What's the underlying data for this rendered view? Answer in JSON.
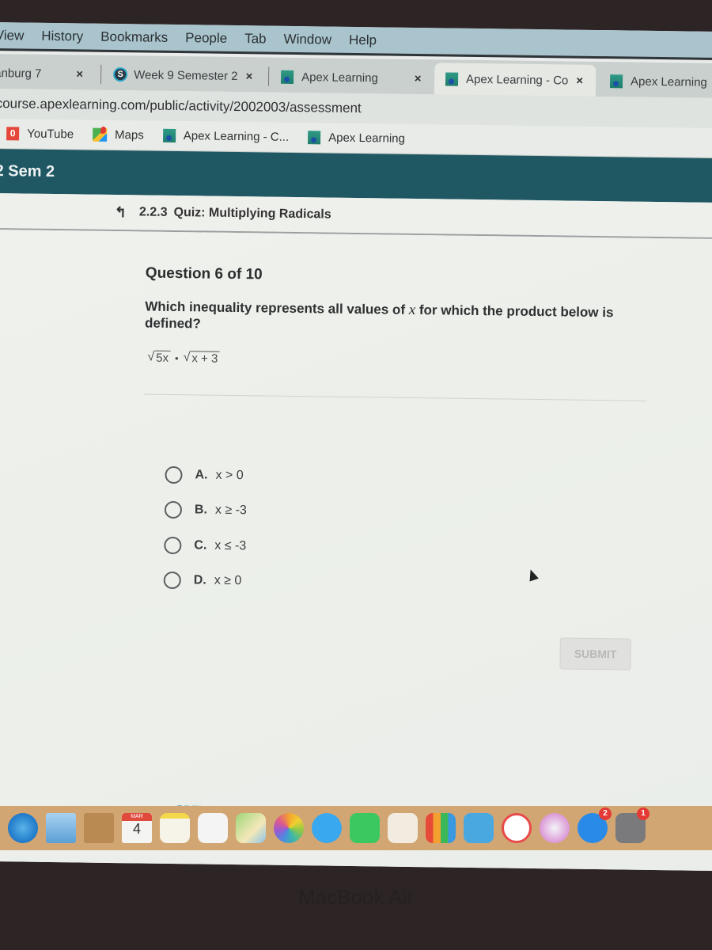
{
  "menubar": {
    "items": [
      "View",
      "History",
      "Bookmarks",
      "People",
      "Tab",
      "Window",
      "Help"
    ]
  },
  "tabs": [
    {
      "label": "anburg 7",
      "icon": "tab-favicon",
      "active": false
    },
    {
      "label": "Week 9 Semester 2",
      "icon": "schoology-icon",
      "active": false
    },
    {
      "label": "Apex Learning",
      "icon": "apex-icon",
      "active": false
    },
    {
      "label": "Apex Learning - Co",
      "icon": "apex-icon",
      "active": true
    },
    {
      "label": "Apex Learning",
      "icon": "apex-icon",
      "active": false
    }
  ],
  "tab_close_glyph": "×",
  "address": {
    "url": "course.apexlearning.com/public/activity/2002003/assessment"
  },
  "bookmarks": [
    {
      "label": "YouTube",
      "icon": "youtube-icon"
    },
    {
      "label": "Maps",
      "icon": "maps-icon"
    },
    {
      "label": "Apex Learning - C...",
      "icon": "apex-icon"
    },
    {
      "label": "Apex Learning",
      "icon": "apex-icon"
    }
  ],
  "course": {
    "title": "2 Sem 2"
  },
  "breadcrumb": {
    "up_glyph": "↰",
    "number": "2.2.3",
    "title": "Quiz:  Multiplying Radicals"
  },
  "question": {
    "counter": "Question 6 of 10",
    "text_before": "Which inequality represents all values of ",
    "variable": "x",
    "text_after": " for which the product below is defined?",
    "expression": {
      "radical1": "5x",
      "operator": "•",
      "radical2": "x + 3",
      "root_glyph": "√"
    }
  },
  "options": [
    {
      "letter": "A.",
      "value": "x > 0",
      "selected": false
    },
    {
      "letter": "B.",
      "value": "x ≥ -3",
      "selected": false
    },
    {
      "letter": "C.",
      "value": "x ≤ -3",
      "selected": false
    },
    {
      "letter": "D.",
      "value": "x ≥ 0",
      "selected": false
    }
  ],
  "actions": {
    "submit_label": "SUBMIT",
    "submit_enabled": false,
    "previous_label": "PREVIOUS",
    "previous_glyph": "←"
  },
  "colors": {
    "course_header": "#1f5763",
    "previous_link": "#2a8aa0",
    "submit_disabled_text": "#b8b9b7"
  },
  "dock": {
    "apps": [
      {
        "name": "safari-icon"
      },
      {
        "name": "mail-icon"
      },
      {
        "name": "contacts-icon"
      },
      {
        "name": "calendar-icon",
        "month": "MAR",
        "day": "4"
      },
      {
        "name": "notes-icon"
      },
      {
        "name": "reminders-icon"
      },
      {
        "name": "maps-app-icon"
      },
      {
        "name": "photos-icon"
      },
      {
        "name": "messages-icon"
      },
      {
        "name": "facetime-icon"
      },
      {
        "name": "pages-icon"
      },
      {
        "name": "numbers-icon"
      },
      {
        "name": "keynote-icon"
      },
      {
        "name": "news-icon"
      },
      {
        "name": "music-icon"
      },
      {
        "name": "app-store-icon",
        "badge": "2"
      },
      {
        "name": "system-preferences-icon",
        "badge": "1"
      }
    ]
  },
  "device": {
    "label": "MacBook Air"
  }
}
